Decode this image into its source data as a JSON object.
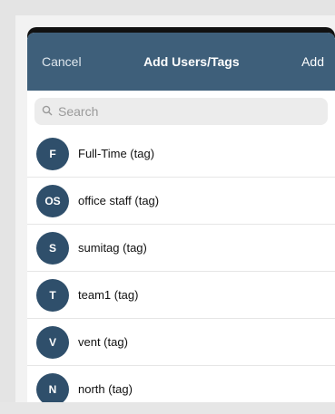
{
  "header": {
    "cancel_label": "Cancel",
    "title": "Add Users/Tags",
    "add_label": "Add"
  },
  "search": {
    "placeholder": "Search",
    "icon": "search-icon"
  },
  "items": [
    {
      "initials": "F",
      "label": "Full-Time (tag)"
    },
    {
      "initials": "OS",
      "label": "office staff (tag)"
    },
    {
      "initials": "S",
      "label": "sumitag (tag)"
    },
    {
      "initials": "T",
      "label": "team1 (tag)"
    },
    {
      "initials": "V",
      "label": "vent (tag)"
    },
    {
      "initials": "N",
      "label": "north (tag)"
    }
  ],
  "colors": {
    "header_bg": "#3e5f7a",
    "avatar_bg": "#2f4f6b"
  }
}
